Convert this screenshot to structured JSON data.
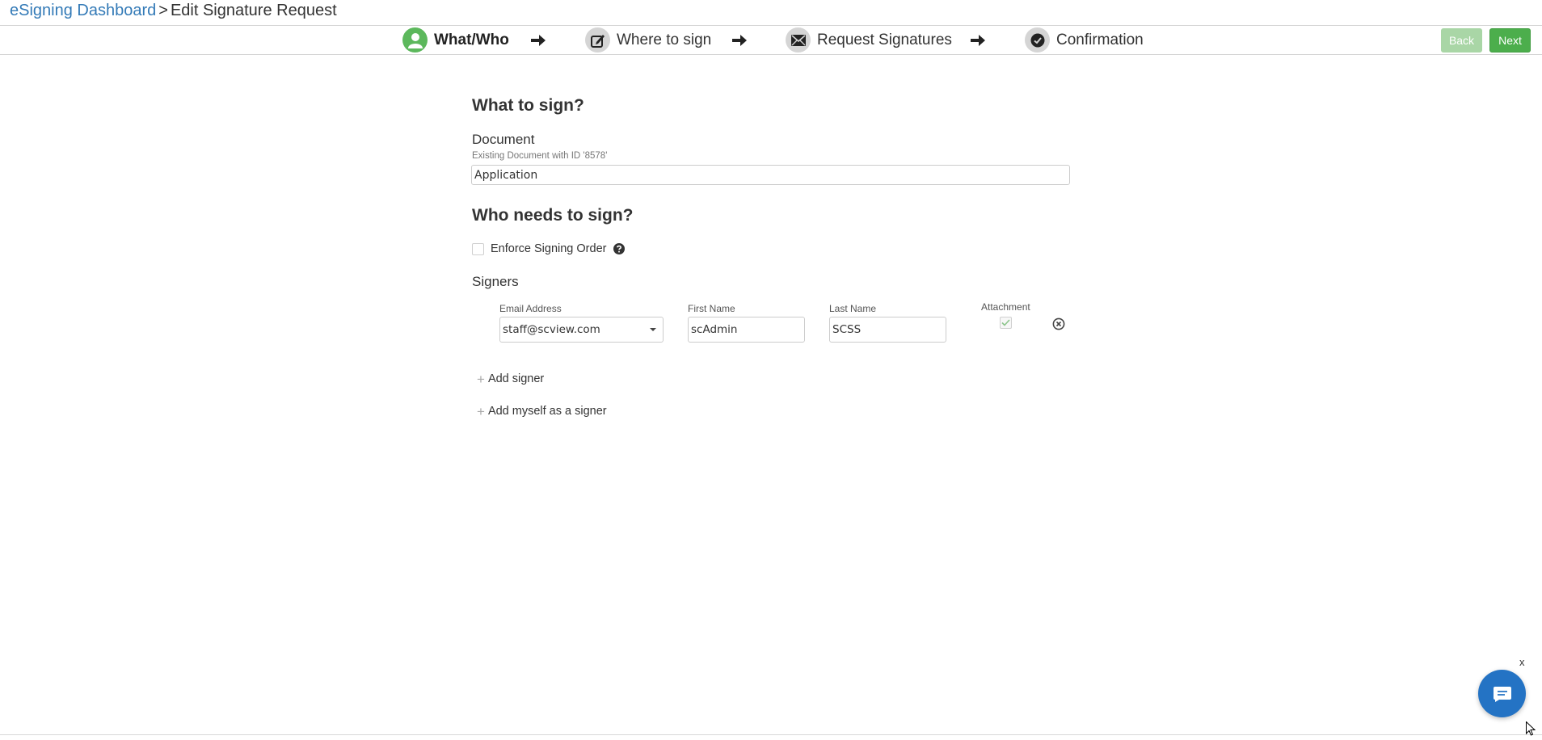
{
  "breadcrumb": {
    "link": "eSigning Dashboard",
    "separator": ">",
    "current": "Edit Signature Request"
  },
  "wizard": {
    "steps": [
      {
        "label": "What/Who",
        "icon": "person-icon",
        "active": true
      },
      {
        "label": "Where to sign",
        "icon": "edit-icon",
        "active": false
      },
      {
        "label": "Request Signatures",
        "icon": "envelope-icon",
        "active": false
      },
      {
        "label": "Confirmation",
        "icon": "check-circle-icon",
        "active": false
      }
    ],
    "back_label": "Back",
    "next_label": "Next"
  },
  "what": {
    "heading": "What to sign?",
    "document_label": "Document",
    "document_hint": "Existing Document with ID '8578'",
    "document_value": "Application"
  },
  "who": {
    "heading": "Who needs to sign?",
    "enforce_label": "Enforce Signing Order",
    "enforce_checked": false,
    "signers_label": "Signers",
    "columns": {
      "email": "Email Address",
      "first": "First Name",
      "last": "Last Name",
      "attachment": "Attachment"
    },
    "signers": [
      {
        "email": "staff@scview.com",
        "first_name": "scAdmin",
        "last_name": "SCSS",
        "attachment": true
      }
    ],
    "add_signer": "Add signer",
    "add_myself": "Add myself as a signer"
  },
  "chat": {
    "close_label": "x"
  },
  "colors": {
    "link": "#337ab7",
    "active_step": "#5cb85c",
    "next_button": "#4cae4c",
    "back_button_disabled": "#a9d6a6",
    "chat_bubble": "#2473c4"
  }
}
